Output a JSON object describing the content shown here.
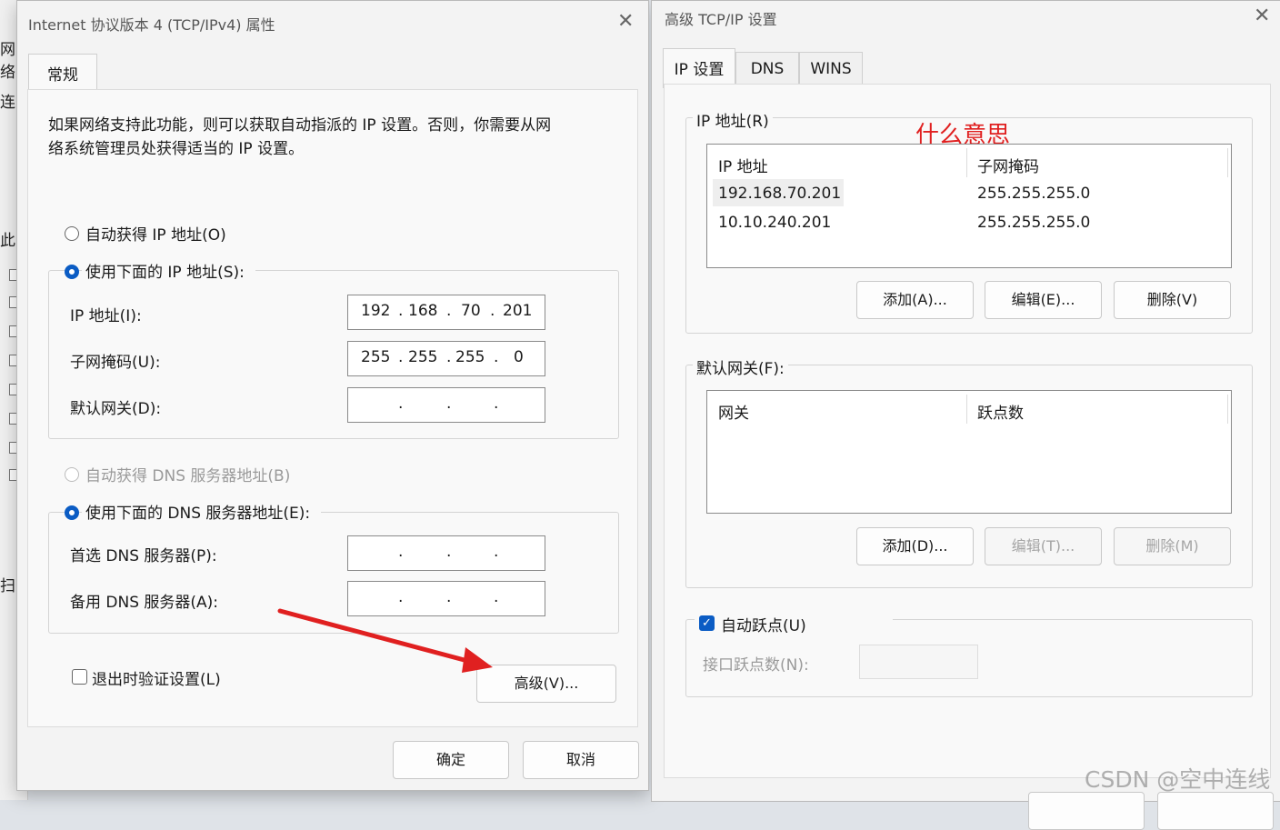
{
  "bg_window": {
    "fragments": [
      "网络",
      "连",
      "此",
      "扫"
    ]
  },
  "ipv4": {
    "title": "Internet 协议版本 4 (TCP/IPv4) 属性",
    "tab_general": "常规",
    "description": [
      "如果网络支持此功能，则可以获取自动指派的 IP 设置。否则，你需要从网",
      "络系统管理员处获得适当的 IP 设置。"
    ],
    "auto_ip_label": "自动获得 IP 地址(O)",
    "manual_ip_label": "使用下面的 IP 地址(S):",
    "ip_label": "IP 地址(I):",
    "ip_octets": [
      "192",
      "168",
      "70",
      "201"
    ],
    "mask_label": "子网掩码(U):",
    "mask_octets": [
      "255",
      "255",
      "255",
      "0"
    ],
    "gateway_label": "默认网关(D):",
    "auto_dns_label": "自动获得 DNS 服务器地址(B)",
    "manual_dns_label": "使用下面的 DNS 服务器地址(E):",
    "preferred_dns_label": "首选 DNS 服务器(P):",
    "alternate_dns_label": "备用 DNS 服务器(A):",
    "validate_label": "退出时验证设置(L)",
    "advanced_btn": "高级(V)...",
    "ok_btn": "确定",
    "cancel_btn": "取消",
    "ip_dot": "."
  },
  "advanced": {
    "title": "高级 TCP/IP 设置",
    "tabs": [
      "IP 设置",
      "DNS",
      "WINS"
    ],
    "ip_group_label": "IP 地址(R)",
    "annotation": "什么意思",
    "ip_cols": [
      "IP 地址",
      "子网掩码"
    ],
    "ip_rows": [
      {
        "ip": "192.168.70.201",
        "mask": "255.255.255.0"
      },
      {
        "ip": "10.10.240.201",
        "mask": "255.255.255.0"
      }
    ],
    "ip_add": "添加(A)...",
    "ip_edit": "编辑(E)...",
    "ip_delete": "删除(V)",
    "gw_group_label": "默认网关(F):",
    "gw_cols": [
      "网关",
      "跃点数"
    ],
    "gw_add": "添加(D)...",
    "gw_edit": "编辑(T)...",
    "gw_delete": "删除(M)",
    "auto_metric_label": "自动跃点(U)",
    "iface_metric_label": "接口跃点数(N):"
  },
  "watermark": "CSDN @空中连线",
  "colors": {
    "accent": "#0b5cc4",
    "arrow": "#e02020",
    "annotation": "#e02020"
  }
}
